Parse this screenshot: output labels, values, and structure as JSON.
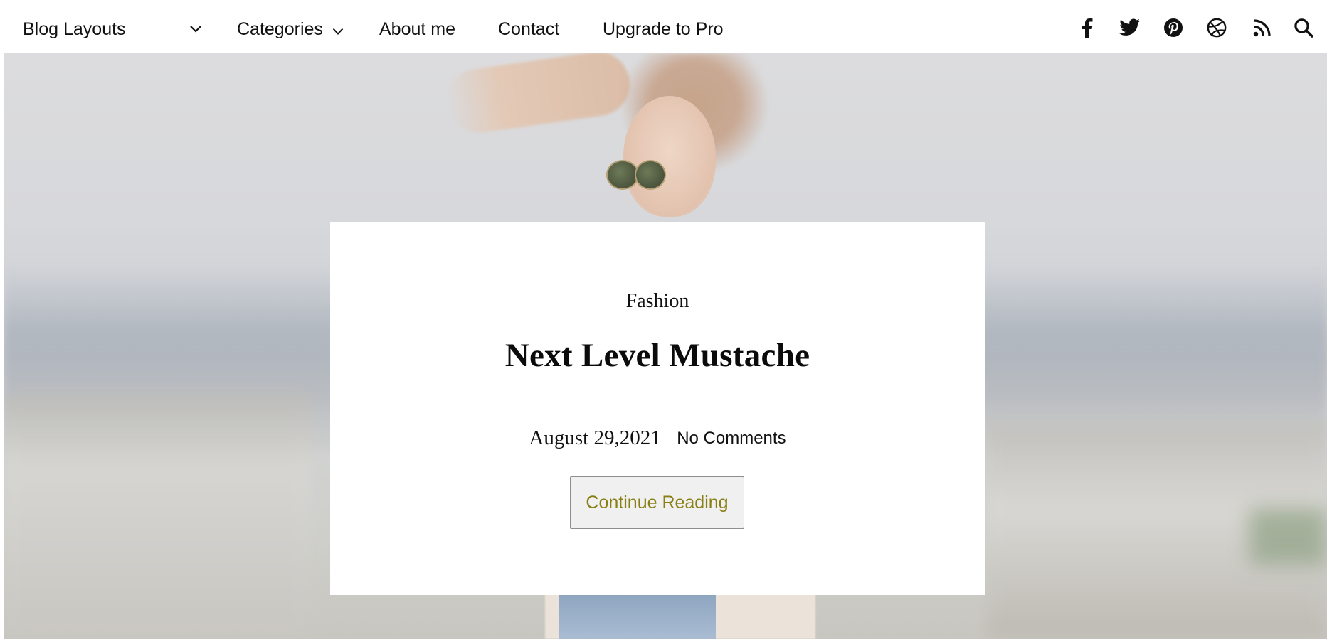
{
  "nav": {
    "items": [
      {
        "label": "Blog Layouts",
        "has_dropdown": true
      },
      {
        "label": "Categories",
        "has_dropdown": true
      },
      {
        "label": "About me",
        "has_dropdown": false
      },
      {
        "label": "Contact",
        "has_dropdown": false
      },
      {
        "label": "Upgrade to Pro",
        "has_dropdown": false
      }
    ],
    "icons": [
      "facebook-icon",
      "twitter-icon",
      "pinterest-icon",
      "dribbble-icon",
      "rss-icon",
      "search-icon"
    ]
  },
  "post": {
    "category": "Fashion",
    "title": "Next Level Mustache",
    "date": "August 29,2021",
    "comments": "No Comments",
    "cta": "Continue Reading"
  },
  "colors": {
    "text": "#111111",
    "card_background": "#ffffff",
    "button_background": "#f0f0f0",
    "button_text": "#8a7f14"
  }
}
